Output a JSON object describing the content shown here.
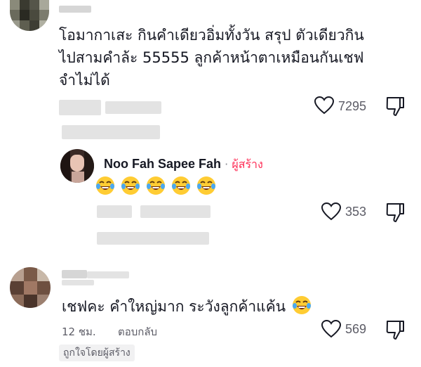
{
  "comments": [
    {
      "text_lines": [
        "โอมากาเสะ กินคำเดียวอิ่มทั้งวัน สรุป ตัวเดียวกิน",
        "ไปสามคำล้ะ 55555 ลูกค้าหน้าตาเหมือนกันเชฟ",
        "จำไม่ได้"
      ],
      "likes": "7295"
    },
    {
      "author": "Noo Fah Sapee Fah",
      "separator": "·",
      "creator_tag": "ผู้สร้าง",
      "emojis": [
        "face-with-tears-of-joy",
        "face-with-tears-of-joy",
        "face-with-tears-of-joy",
        "face-with-tears-of-joy",
        "face-with-tears-of-joy"
      ],
      "likes": "353"
    },
    {
      "text": "เชฟคะ คำใหญ่มาก ระวังลูกค้าแค้น",
      "time": "12 ชม.",
      "reply": "ตอบกลับ",
      "likes": "569",
      "liked_by_creator": "ถูกใจโดยผู้สร้าง"
    }
  ],
  "icons": {
    "like": "heart-outline-icon",
    "dislike": "thumbs-down-icon",
    "emoji": "face-with-tears-of-joy"
  },
  "colors": {
    "text": "#161823",
    "muted": "#5c5c66",
    "creator": "#fe2c55",
    "badge_bg": "#f1f1f2"
  }
}
